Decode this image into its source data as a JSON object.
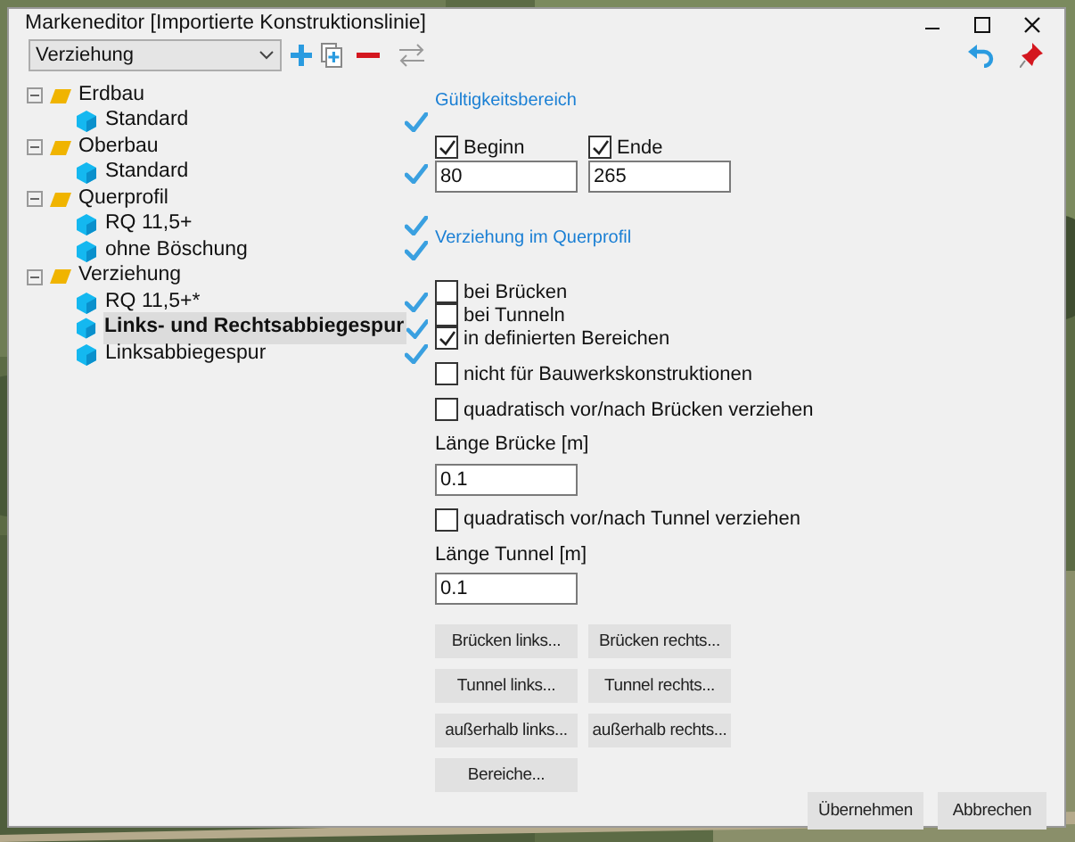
{
  "window": {
    "title": "Markeneditor [Importierte Konstruktionslinie]"
  },
  "toolbar": {
    "dropdown": "Verziehung"
  },
  "tree": [
    {
      "label": "Erdbau",
      "expanded": true,
      "children": [
        {
          "label": "Standard",
          "selected": false,
          "checked": true
        }
      ]
    },
    {
      "label": "Oberbau",
      "expanded": true,
      "children": [
        {
          "label": "Standard",
          "selected": false,
          "checked": true
        }
      ]
    },
    {
      "label": "Querprofil",
      "expanded": true,
      "children": [
        {
          "label": "RQ 11,5+",
          "selected": false,
          "checked": true
        },
        {
          "label": "ohne Böschung",
          "selected": false,
          "checked": true
        }
      ]
    },
    {
      "label": "Verziehung",
      "expanded": true,
      "children": [
        {
          "label": "RQ 11,5+*",
          "selected": false,
          "checked": true
        },
        {
          "label": "Links- und Rechtsabbiegespur",
          "selected": true,
          "checked": true
        },
        {
          "label": "Linksabbiegespur",
          "selected": false,
          "checked": true
        }
      ]
    }
  ],
  "validity": {
    "title": "Gültigkeitsbereich",
    "fields": [
      {
        "label": "Beginn",
        "checked": true,
        "value": "80"
      },
      {
        "label": "Ende",
        "checked": true,
        "value": "265"
      }
    ]
  },
  "profile": {
    "title": "Verziehung im Querprofil",
    "options": [
      {
        "label": "bei Brücken",
        "checked": false
      },
      {
        "label": "bei Tunneln",
        "checked": false
      },
      {
        "label": "in definierten Bereichen",
        "checked": true
      }
    ],
    "exclude": {
      "label": "nicht für Bauwerkskonstruktionen",
      "checked": false
    },
    "lengths": [
      {
        "option": {
          "label": "quadratisch vor/nach Brücken verziehen",
          "checked": false
        },
        "label": "Länge Brücke [m]",
        "value": "0.1"
      },
      {
        "option": {
          "label": "quadratisch vor/nach Tunnel verziehen",
          "checked": false
        },
        "label": "Länge Tunnel [m]",
        "value": "0.1"
      }
    ]
  },
  "buttons": [
    "Brücken links...",
    "Brücken rechts...",
    "Tunnel links...",
    "Tunnel rechts...",
    "außerhalb links...",
    "außerhalb rechts...",
    "Bereiche..."
  ],
  "footer": [
    "Übernehmen",
    "Abbrechen"
  ]
}
